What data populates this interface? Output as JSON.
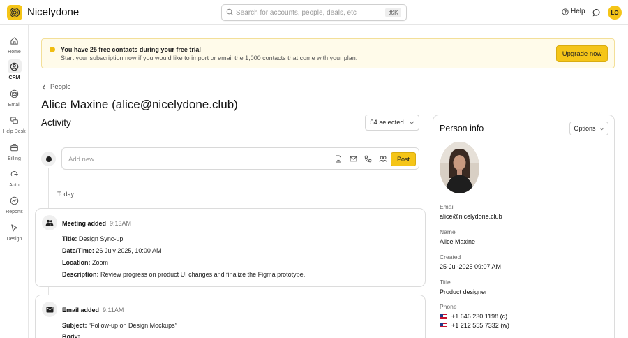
{
  "app": {
    "brand": "Nicelydone",
    "search_placeholder": "Search for accounts, people, deals, etc",
    "search_shortcut": "⌘K",
    "help_label": "Help",
    "user_initials": "LO"
  },
  "sidebar": {
    "items": [
      {
        "label": "Home",
        "icon": "home-icon"
      },
      {
        "label": "CRM",
        "icon": "crm-icon",
        "active": true
      },
      {
        "label": "Email",
        "icon": "email-icon"
      },
      {
        "label": "Help Desk",
        "icon": "help-desk-icon"
      },
      {
        "label": "Billing",
        "icon": "billing-icon"
      },
      {
        "label": "Auth",
        "icon": "auth-icon"
      },
      {
        "label": "Reports",
        "icon": "reports-icon"
      },
      {
        "label": "Design",
        "icon": "design-icon"
      }
    ]
  },
  "banner": {
    "title": "You have 25 free contacts during your free trial",
    "text": "Start your subscription now if you would like to import or email the 1,000 contacts that come with your plan.",
    "cta": "Upgrade now"
  },
  "breadcrumb": {
    "label": "People"
  },
  "page": {
    "title": "Alice Maxine (alice@nicelydone.club)"
  },
  "activity": {
    "title": "Activity",
    "selected_label": "54 selected",
    "composer_placeholder": "Add new ...",
    "post_label": "Post",
    "group_label": "Today",
    "items": [
      {
        "title": "Meeting added",
        "time": "9:13AM",
        "icon": "people-icon",
        "rows": [
          {
            "key": "Title:",
            "value": "Design Sync-up"
          },
          {
            "key": "Date/Time:",
            "value": "26 July 2025, 10:00 AM"
          },
          {
            "key": "Location:",
            "value": "Zoom"
          },
          {
            "key": "Description:",
            "value": "Review progress on product UI changes and finalize the Figma prototype."
          }
        ]
      },
      {
        "title": "Email added",
        "time": "9:11AM",
        "icon": "envelope-icon",
        "rows": [
          {
            "key": "Subject:",
            "value": "“Follow-up on Design Mockups”"
          },
          {
            "key": "Body:",
            "value": ""
          }
        ]
      }
    ]
  },
  "person": {
    "title": "Person info",
    "options_label": "Options",
    "fields": [
      {
        "label": "Email",
        "value": "alice@nicelydone.club"
      },
      {
        "label": "Name",
        "value": "Alice Maxine"
      },
      {
        "label": "Created",
        "value": "25-Jul-2025 09:07 AM"
      },
      {
        "label": "Title",
        "value": "Product designer"
      }
    ],
    "phone_label": "Phone",
    "phones": [
      "+1 646 230 1198 (c)",
      "+1 212 555 7332 (w)"
    ]
  },
  "colors": {
    "accent": "#f5c518",
    "banner_bg": "#fffbea"
  }
}
